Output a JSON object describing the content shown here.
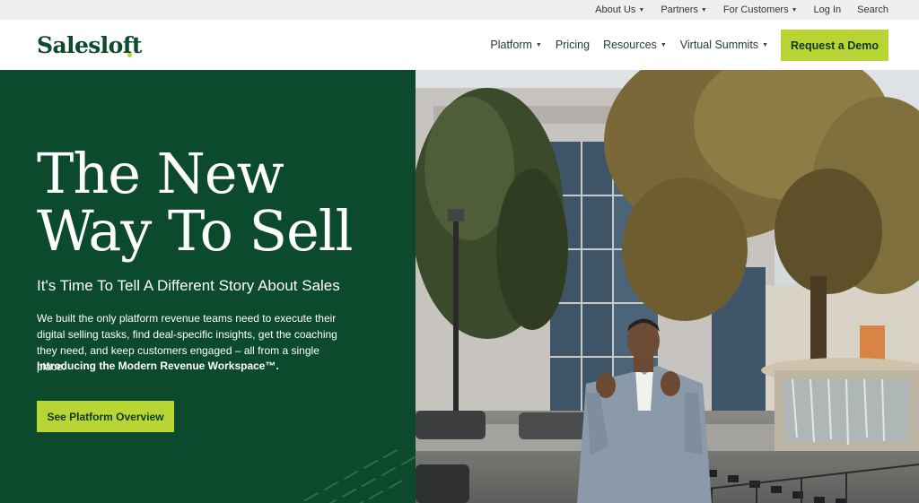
{
  "utility_nav": [
    {
      "label": "About Us",
      "caret": true
    },
    {
      "label": "Partners",
      "caret": true
    },
    {
      "label": "For Customers",
      "caret": true
    },
    {
      "label": "Log In",
      "caret": false
    },
    {
      "label": "Search",
      "caret": false
    }
  ],
  "header": {
    "logo_text": "Salesloft",
    "nav": [
      {
        "label": "Platform",
        "caret": true
      },
      {
        "label": "Pricing",
        "caret": false
      },
      {
        "label": "Resources",
        "caret": true
      },
      {
        "label": "Virtual Summits",
        "caret": true
      }
    ],
    "demo_button": "Request a Demo"
  },
  "hero": {
    "headline_line1": "The New",
    "headline_line2": "Way To Sell",
    "subheading": "It's Time To Tell A Different Story About Sales",
    "body": "We built the only platform revenue teams need to execute their digital selling tasks, find deal-specific insights, get the coaching they need, and keep customers engaged – all from a single place.",
    "body_strong": "Introducing the Modern Revenue Workspace™.",
    "cta": "See Platform Overview"
  },
  "colors": {
    "brand_green": "#0c4a2d",
    "accent_lime": "#b9d533",
    "utility_bg": "#efefef"
  }
}
